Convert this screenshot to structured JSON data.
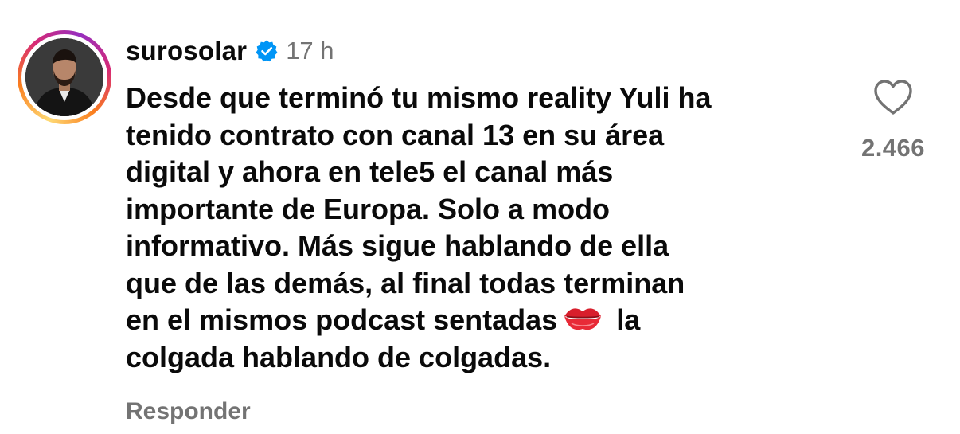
{
  "comment": {
    "username": "surosolar",
    "verified_icon": "verified-badge-icon",
    "time": "17 h",
    "lines": [
      "Desde que terminó tu mismo reality Yuli ha",
      "tenido contrato con canal 13 en su área",
      "digital y ahora en tele5 el canal más",
      "importante de Europa. Solo a modo",
      "informativo. Más sigue hablando de ella",
      "que de las demás, al final todas terminan",
      "en el mismos podcast sentadas",
      "la",
      "colgada hablando de colgadas."
    ],
    "emoji": "💋",
    "reply_label": "Responder",
    "like_icon": "heart-outline-icon",
    "like_count": "2.466",
    "accent_color": "#0095f6",
    "muted_color": "#737373"
  }
}
